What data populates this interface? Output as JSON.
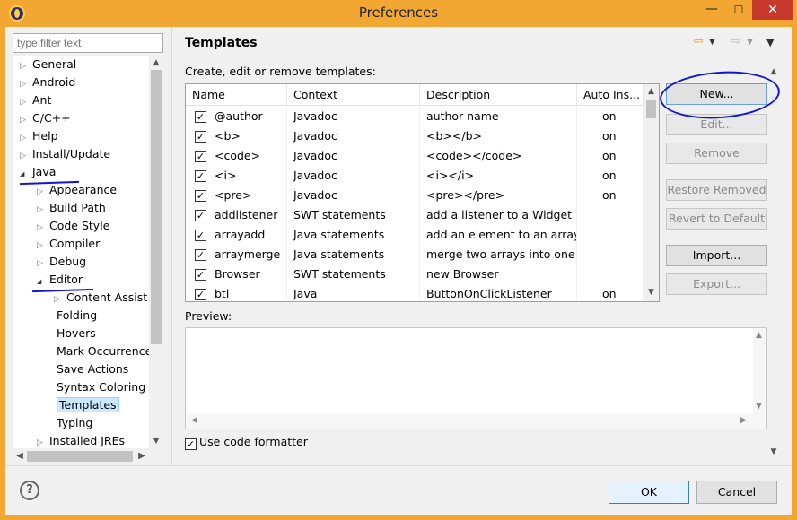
{
  "window": {
    "title": "Preferences",
    "minimize_glyph": "—",
    "maximize_glyph": "☐",
    "close_glyph": "✕"
  },
  "sidebar": {
    "filter_placeholder": "type filter text",
    "tree": [
      {
        "label": "General",
        "level": 0,
        "state": "collapsed"
      },
      {
        "label": "Android",
        "level": 0,
        "state": "collapsed"
      },
      {
        "label": "Ant",
        "level": 0,
        "state": "collapsed"
      },
      {
        "label": "C/C++",
        "level": 0,
        "state": "collapsed"
      },
      {
        "label": "Help",
        "level": 0,
        "state": "collapsed"
      },
      {
        "label": "Install/Update",
        "level": 0,
        "state": "collapsed"
      },
      {
        "label": "Java",
        "level": 0,
        "state": "expanded"
      },
      {
        "label": "Appearance",
        "level": 1,
        "state": "collapsed"
      },
      {
        "label": "Build Path",
        "level": 1,
        "state": "collapsed"
      },
      {
        "label": "Code Style",
        "level": 1,
        "state": "collapsed"
      },
      {
        "label": "Compiler",
        "level": 1,
        "state": "collapsed"
      },
      {
        "label": "Debug",
        "level": 1,
        "state": "collapsed"
      },
      {
        "label": "Editor",
        "level": 1,
        "state": "expanded"
      },
      {
        "label": "Content Assist",
        "level": 2,
        "state": "collapsed"
      },
      {
        "label": "Folding",
        "level": 2,
        "state": "leaf"
      },
      {
        "label": "Hovers",
        "level": 2,
        "state": "leaf"
      },
      {
        "label": "Mark Occurrences",
        "level": 2,
        "state": "leaf"
      },
      {
        "label": "Save Actions",
        "level": 2,
        "state": "leaf"
      },
      {
        "label": "Syntax Coloring",
        "level": 2,
        "state": "leaf"
      },
      {
        "label": "Templates",
        "level": 2,
        "state": "leaf",
        "selected": true
      },
      {
        "label": "Typing",
        "level": 2,
        "state": "leaf"
      },
      {
        "label": "Installed JREs",
        "level": 1,
        "state": "collapsed"
      }
    ]
  },
  "page": {
    "title": "Templates",
    "description": "Create, edit or remove templates:",
    "table": {
      "columns": [
        "Name",
        "Context",
        "Description",
        "Auto Ins..."
      ],
      "rows": [
        {
          "name": "@author",
          "context": "Javadoc",
          "description": "author name",
          "auto": "on",
          "checked": true
        },
        {
          "name": "<b>",
          "context": "Javadoc",
          "description": "<b></b>",
          "auto": "on",
          "checked": true
        },
        {
          "name": "<code>",
          "context": "Javadoc",
          "description": "<code></code>",
          "auto": "on",
          "checked": true
        },
        {
          "name": "<i>",
          "context": "Javadoc",
          "description": "<i></i>",
          "auto": "on",
          "checked": true
        },
        {
          "name": "<pre>",
          "context": "Javadoc",
          "description": "<pre></pre>",
          "auto": "on",
          "checked": true
        },
        {
          "name": "addlistener",
          "context": "SWT statements",
          "description": "add a listener to a Widget",
          "auto": "",
          "checked": true
        },
        {
          "name": "arrayadd",
          "context": "Java statements",
          "description": "add an element to an array",
          "auto": "",
          "checked": true
        },
        {
          "name": "arraymerge",
          "context": "Java statements",
          "description": "merge two arrays into one",
          "auto": "",
          "checked": true
        },
        {
          "name": "Browser",
          "context": "SWT statements",
          "description": "new Browser",
          "auto": "",
          "checked": true
        },
        {
          "name": "btl",
          "context": "Java",
          "description": "ButtonOnClickListener",
          "auto": "on",
          "checked": true
        }
      ]
    },
    "buttons": {
      "new": "New...",
      "edit": "Edit...",
      "remove": "Remove",
      "restore_removed": "Restore Removed",
      "revert_to_default": "Revert to Default",
      "import": "Import...",
      "export": "Export..."
    },
    "preview_label": "Preview:",
    "use_code_formatter": "Use code formatter"
  },
  "footer": {
    "ok": "OK",
    "cancel": "Cancel",
    "help_glyph": "?"
  },
  "colors": {
    "title_bar": "#f3a733",
    "close_button": "#c7382d",
    "annotation_ink": "#1414d0",
    "selection": "#cce8ff"
  }
}
